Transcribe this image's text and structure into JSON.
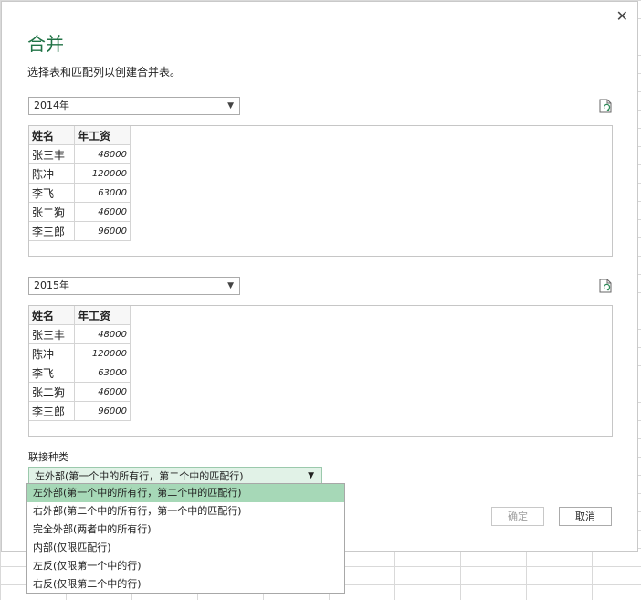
{
  "dialog": {
    "title": "合并",
    "subtitle": "选择表和匹配列以创建合并表。",
    "close_label": "✕"
  },
  "table1": {
    "select_value": "2014年",
    "headers": [
      "姓名",
      "年工资"
    ],
    "rows": [
      [
        "张三丰",
        "48000"
      ],
      [
        "陈冲",
        "120000"
      ],
      [
        "李飞",
        "63000"
      ],
      [
        "张二狗",
        "46000"
      ],
      [
        "李三郎",
        "96000"
      ]
    ]
  },
  "table2": {
    "select_value": "2015年",
    "headers": [
      "姓名",
      "年工资"
    ],
    "rows": [
      [
        "张三丰",
        "48000"
      ],
      [
        "陈冲",
        "120000"
      ],
      [
        "李飞",
        "63000"
      ],
      [
        "张二狗",
        "46000"
      ],
      [
        "李三郎",
        "96000"
      ]
    ]
  },
  "join": {
    "label": "联接种类",
    "selected": "左外部(第一个中的所有行，第二个中的匹配行)",
    "options": [
      "左外部(第一个中的所有行，第二个中的匹配行)",
      "右外部(第二个中的所有行，第一个中的匹配行)",
      "完全外部(两者中的所有行)",
      "内部(仅限匹配行)",
      "左反(仅限第一个中的行)",
      "右反(仅限第二个中的行)"
    ]
  },
  "buttons": {
    "ok": "确定",
    "cancel": "取消"
  },
  "colors": {
    "title": "#217346",
    "selected_option": "#a6d8b7",
    "join_select_bg": "#e1f2e7"
  }
}
